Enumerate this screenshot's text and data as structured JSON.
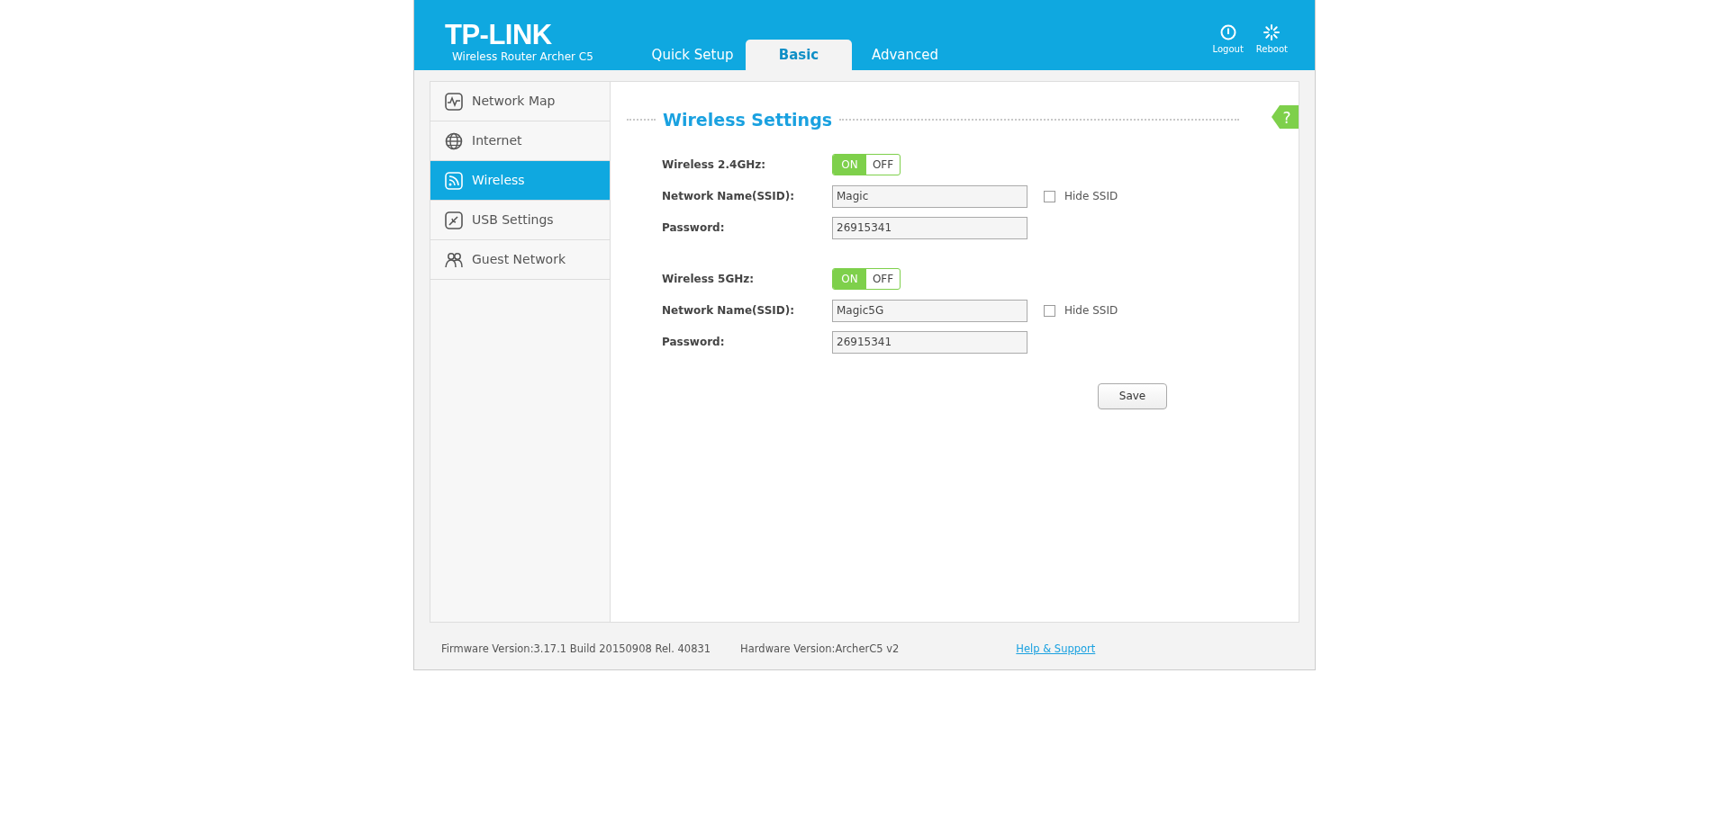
{
  "header": {
    "logo": "TP-LINK",
    "model": "Wireless Router Archer C5",
    "tabs": [
      {
        "label": "Quick Setup",
        "selected": false
      },
      {
        "label": "Basic",
        "selected": true
      },
      {
        "label": "Advanced",
        "selected": false
      }
    ],
    "actions": [
      {
        "label": "Logout",
        "kind": "logout"
      },
      {
        "label": "Reboot",
        "kind": "reboot"
      }
    ]
  },
  "sidebar": {
    "items": [
      {
        "label": "Network Map",
        "kind": "map",
        "selected": false
      },
      {
        "label": "Internet",
        "kind": "globe",
        "selected": false
      },
      {
        "label": "Wireless",
        "kind": "wifi",
        "selected": true
      },
      {
        "label": "USB Settings",
        "kind": "usb",
        "selected": false
      },
      {
        "label": "Guest Network",
        "kind": "guest",
        "selected": false
      }
    ]
  },
  "content": {
    "title": "Wireless Settings",
    "help": "?",
    "bands": [
      {
        "label": "Wireless 2.4GHz:",
        "on": true,
        "on_label": "ON",
        "off_label": "OFF",
        "ssid": {
          "label": "Network Name(SSID):",
          "value": "Magic",
          "hide_label": "Hide SSID",
          "hide_checked": false
        },
        "password": {
          "label": "Password:",
          "value": "26915341"
        }
      },
      {
        "label": "Wireless 5GHz:",
        "on": true,
        "on_label": "ON",
        "off_label": "OFF",
        "ssid": {
          "label": "Network Name(SSID):",
          "value": "Magic5G",
          "hide_label": "Hide SSID",
          "hide_checked": false
        },
        "password": {
          "label": "Password:",
          "value": "26915341"
        }
      }
    ],
    "save": "Save"
  },
  "footer": {
    "firmware": "Firmware Version:3.17.1 Build 20150908 Rel. 40831",
    "hardware": "Hardware Version:ArcherC5 v2",
    "link": "Help & Support"
  }
}
